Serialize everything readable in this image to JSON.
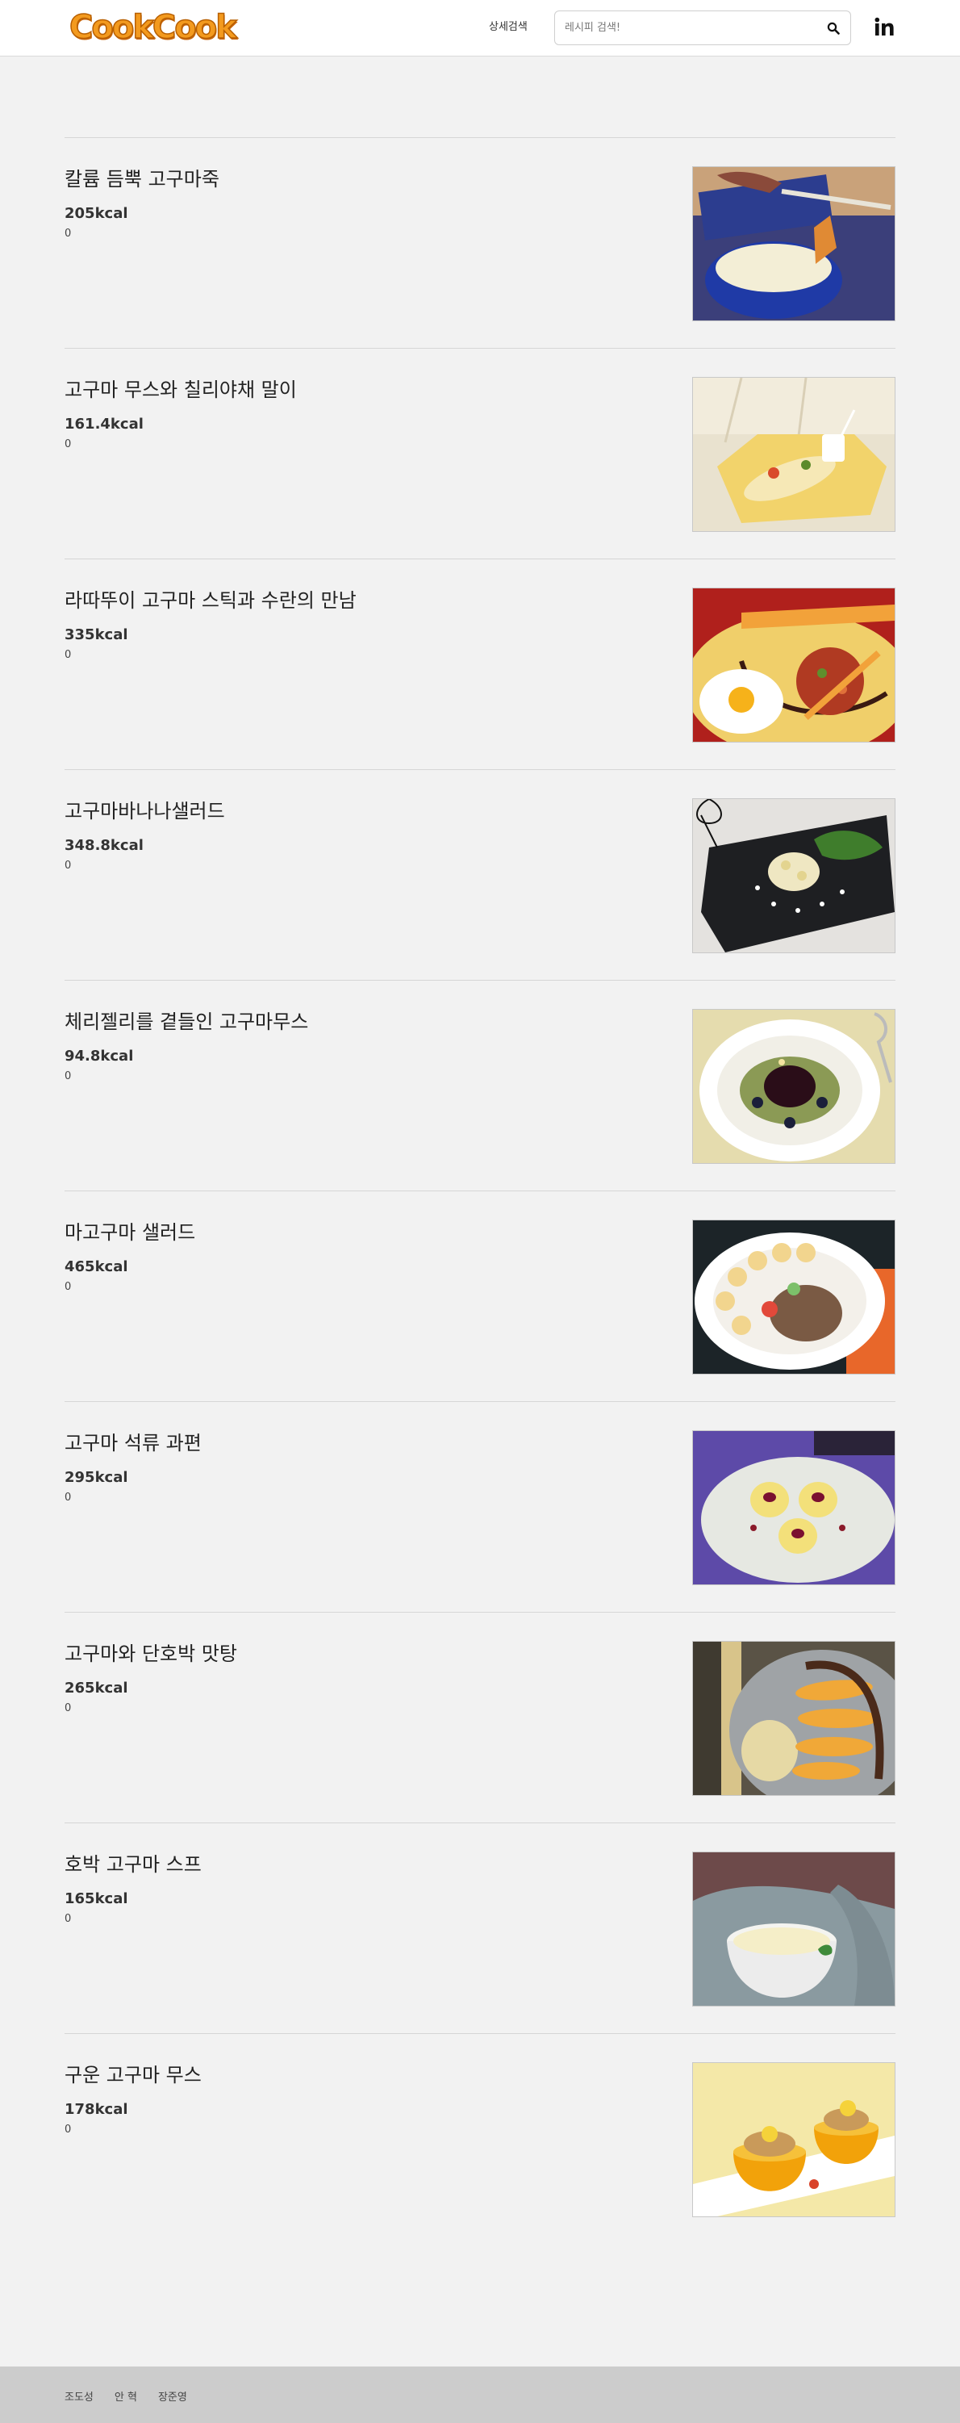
{
  "header": {
    "logo_text": "CookCook",
    "advanced_search_label": "상세검색",
    "search_placeholder": "레시피 검색!",
    "search_icon": "search-icon",
    "social_icon": "linkedin-icon"
  },
  "recipes": [
    {
      "title": "칼륨 듬뿍 고구마죽",
      "kcal": "205kcal",
      "count": "0",
      "image": "sweet-potato-porridge-photo"
    },
    {
      "title": "고구마 무스와 칠리야채 말이",
      "kcal": "161.4kcal",
      "count": "0",
      "image": "mousse-vegetable-rolls-photo"
    },
    {
      "title": "라따뚜이 고구마 스틱과 수란의 만남",
      "kcal": "335kcal",
      "count": "0",
      "image": "ratatouille-sticks-egg-photo"
    },
    {
      "title": "고구마바나나샐러드",
      "kcal": "348.8kcal",
      "count": "0",
      "image": "banana-salad-photo"
    },
    {
      "title": "체리젤리를 곁들인 고구마무스",
      "kcal": "94.8kcal",
      "count": "0",
      "image": "cherry-jelly-mousse-photo"
    },
    {
      "title": "마고구마 샐러드",
      "kcal": "465kcal",
      "count": "0",
      "image": "yam-salad-photo"
    },
    {
      "title": "고구마 석류 과편",
      "kcal": "295kcal",
      "count": "0",
      "image": "pomegranate-jelly-photo"
    },
    {
      "title": "고구마와 단호박 맛탕",
      "kcal": "265kcal",
      "count": "0",
      "image": "candied-pumpkin-photo"
    },
    {
      "title": "호박 고구마 스프",
      "kcal": "165kcal",
      "count": "0",
      "image": "pumpkin-soup-photo"
    },
    {
      "title": "구운 고구마 무스",
      "kcal": "178kcal",
      "count": "0",
      "image": "baked-mousse-photo"
    }
  ],
  "footer": {
    "names": [
      "조도성",
      "안 혁",
      "장준영"
    ]
  },
  "colors": {
    "background": "#f2f2f2",
    "header_bg": "#ffffff",
    "footer_bg": "#cccccc",
    "logo_orange": "#f39a1e"
  }
}
